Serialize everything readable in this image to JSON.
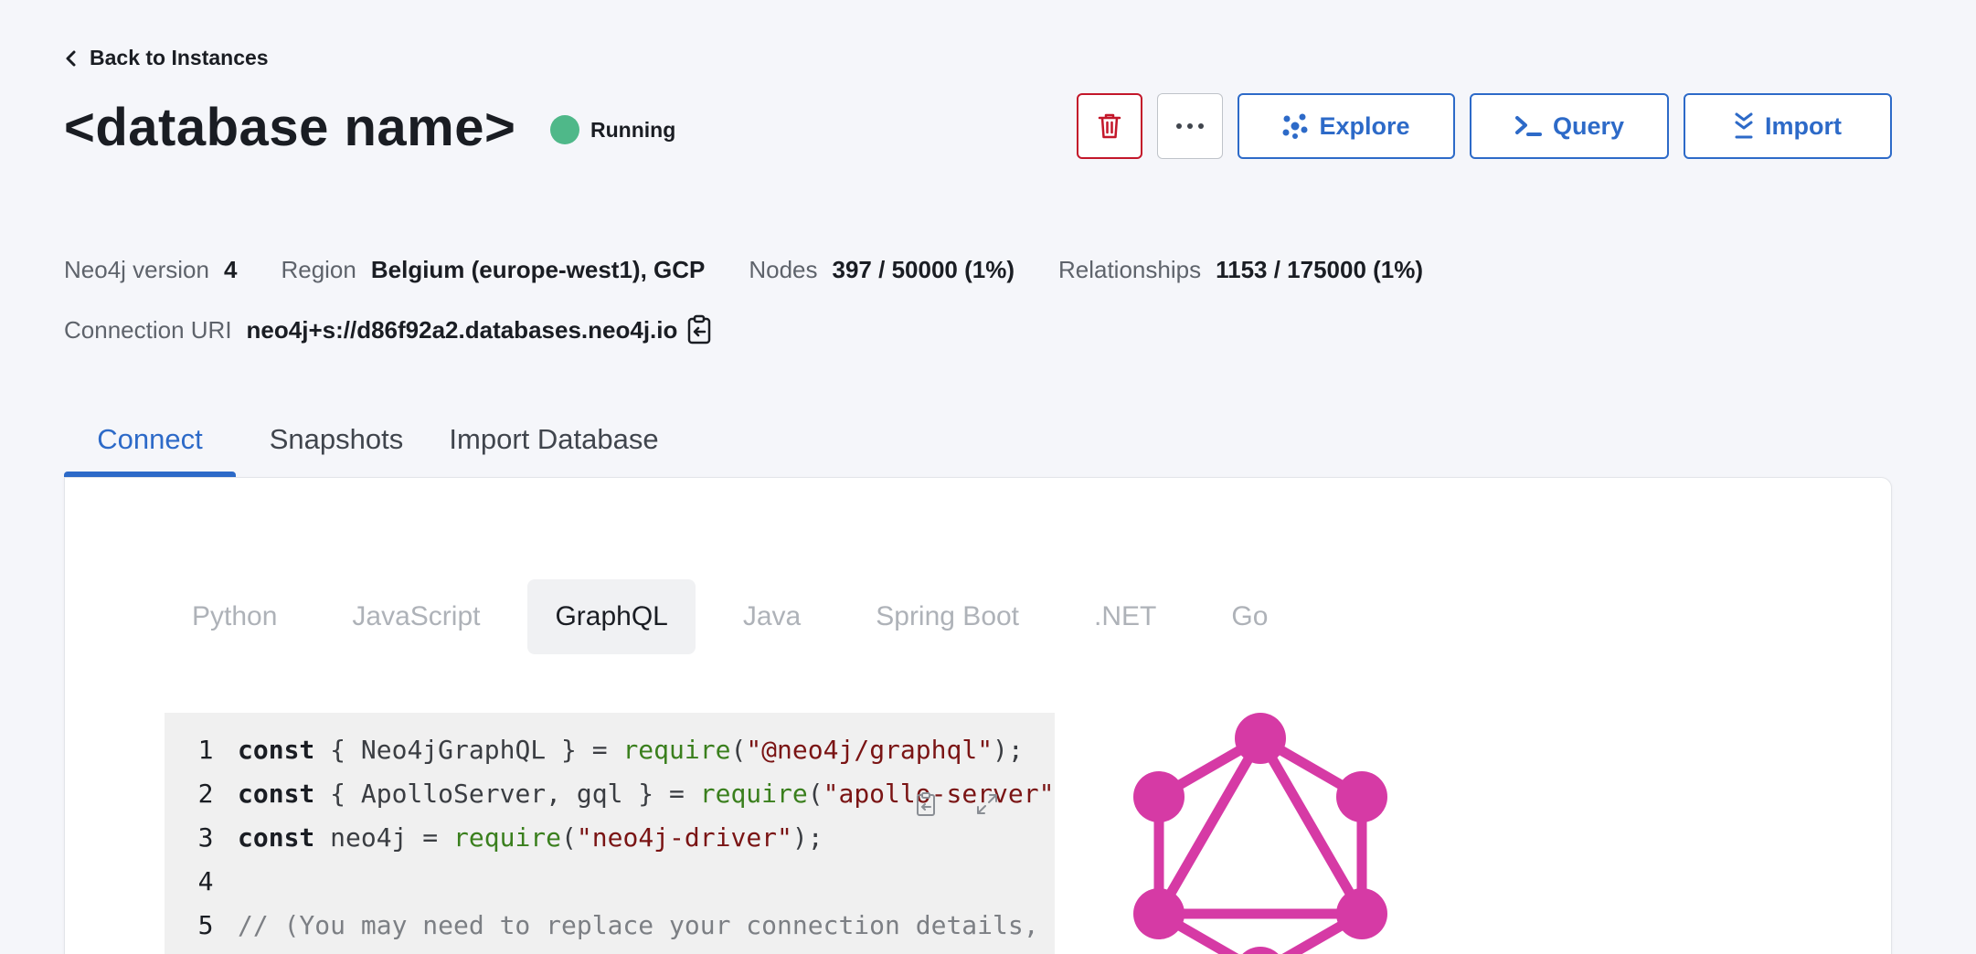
{
  "nav": {
    "back_label": "Back to Instances"
  },
  "instance": {
    "title": "<database name>",
    "status": "Running",
    "status_color": "#4fb889"
  },
  "actions": {
    "delete_icon": "trash-icon",
    "more_icon": "ellipsis-icon",
    "explore_label": "Explore",
    "query_label": "Query",
    "import_label": "Import"
  },
  "meta": {
    "version_label": "Neo4j version",
    "version_value": "4",
    "region_label": "Region",
    "region_value": "Belgium (europe-west1), GCP",
    "nodes_label": "Nodes",
    "nodes_value": "397 / 50000 (1%)",
    "relationships_label": "Relationships",
    "relationships_value": "1153 / 175000 (1%)",
    "uri_label": "Connection URI",
    "uri_value": "neo4j+s://d86f92a2.databases.neo4j.io"
  },
  "tabs": [
    {
      "label": "Connect",
      "active": true
    },
    {
      "label": "Snapshots",
      "active": false
    },
    {
      "label": "Import Database",
      "active": false
    }
  ],
  "languages": [
    {
      "label": "Python",
      "active": false
    },
    {
      "label": "JavaScript",
      "active": false
    },
    {
      "label": "GraphQL",
      "active": true
    },
    {
      "label": "Java",
      "active": false
    },
    {
      "label": "Spring Boot",
      "active": false
    },
    {
      "label": ".NET",
      "active": false
    },
    {
      "label": "Go",
      "active": false
    }
  ],
  "code": {
    "lines": [
      {
        "num": "1",
        "parts": [
          [
            "kw",
            "const"
          ],
          [
            "pl",
            " { Neo4jGraphQL } = "
          ],
          [
            "fn",
            "require"
          ],
          [
            "pl",
            "("
          ],
          [
            "str",
            "\"@neo4j/graphql\""
          ],
          [
            "pl",
            ");"
          ]
        ]
      },
      {
        "num": "2",
        "parts": [
          [
            "kw",
            "const"
          ],
          [
            "pl",
            " { ApolloServer, gql } = "
          ],
          [
            "fn",
            "require"
          ],
          [
            "pl",
            "("
          ],
          [
            "str",
            "\"apollo-server\""
          ]
        ]
      },
      {
        "num": "3",
        "parts": [
          [
            "kw",
            "const"
          ],
          [
            "pl",
            " neo4j = "
          ],
          [
            "fn",
            "require"
          ],
          [
            "pl",
            "("
          ],
          [
            "str",
            "\"neo4j-driver\""
          ],
          [
            "pl",
            ");"
          ]
        ]
      },
      {
        "num": "4",
        "parts": []
      },
      {
        "num": "5",
        "parts": [
          [
            "cm",
            "// (You may need to replace your connection details, u"
          ]
        ]
      }
    ]
  },
  "colors": {
    "accent": "#2d6ac8",
    "danger": "#c3172a",
    "graphql": "#d63aa5"
  }
}
